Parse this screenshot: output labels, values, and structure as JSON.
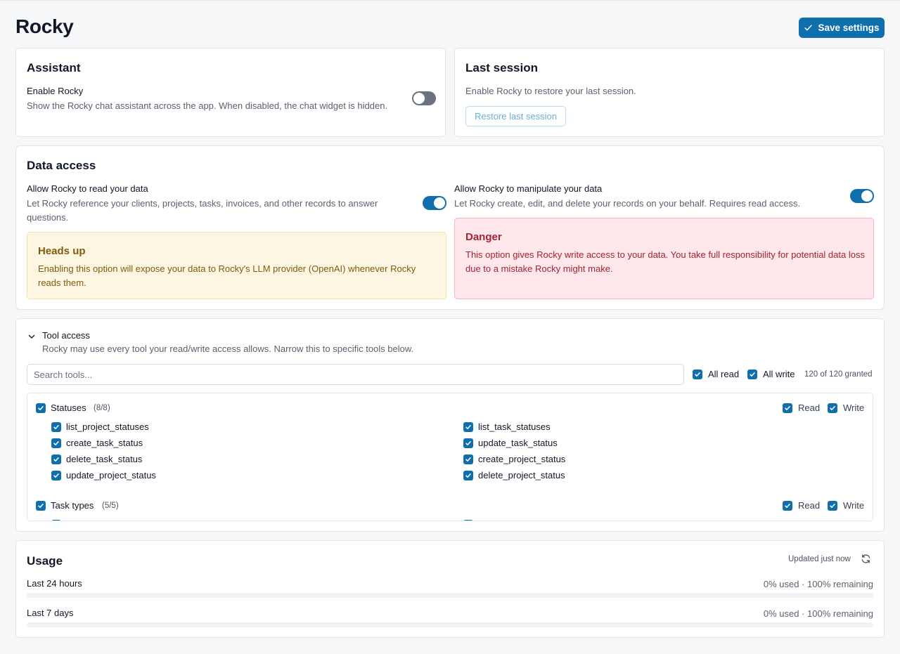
{
  "header": {
    "title": "Rocky",
    "save_label": "Save settings"
  },
  "assistant": {
    "title": "Assistant",
    "enable_label": "Enable Rocky",
    "enable_desc": "Show the Rocky chat assistant across the app. When disabled, the chat widget is hidden.",
    "enabled": false
  },
  "last_session": {
    "title": "Last session",
    "desc": "Enable Rocky to restore your last session.",
    "button": "Restore last session"
  },
  "data_access": {
    "title": "Data access",
    "read_label": "Allow Rocky to read your data",
    "read_desc": "Let Rocky reference your clients, projects, tasks, invoices, and other records to answer questions.",
    "read_enabled": true,
    "write_label": "Allow Rocky to manipulate your data",
    "write_desc": "Let Rocky create, edit, and delete your records on your behalf. Requires read access.",
    "write_enabled": true,
    "warning": {
      "title": "Heads up",
      "text": "Enabling this option will expose your data to Rocky's LLM provider (OpenAI) whenever Rocky reads them."
    },
    "danger": {
      "title": "Danger",
      "text": "This option gives Rocky write access to your data. You take full responsibility for potential data loss due to a mistake Rocky might make."
    }
  },
  "tool_access": {
    "title": "Tool access",
    "desc": "Rocky may use every tool your read/write access allows. Narrow this to specific tools below.",
    "search_placeholder": "Search tools...",
    "all_read": "All read",
    "all_write": "All write",
    "granted": "120 of 120 granted",
    "read_label": "Read",
    "write_label": "Write",
    "groups": [
      {
        "name": "Statuses",
        "count": "(8/8)",
        "left": [
          "list_project_statuses",
          "create_task_status",
          "delete_task_status",
          "update_project_status"
        ],
        "right": [
          "list_task_statuses",
          "update_task_status",
          "create_project_status",
          "delete_project_status"
        ]
      },
      {
        "name": "Task types",
        "count": "(5/5)"
      }
    ]
  },
  "usage": {
    "title": "Usage",
    "updated": "Updated just now",
    "rows": [
      {
        "label": "Last 24 hours",
        "value": "0% used · 100% remaining",
        "used": 0
      },
      {
        "label": "Last 7 days",
        "value": "0% used · 100% remaining",
        "used": 0
      }
    ]
  },
  "colors": {
    "accent": "#0f6fad",
    "warning_bg": "#fdf6e3",
    "danger_bg": "#fde7ea"
  }
}
